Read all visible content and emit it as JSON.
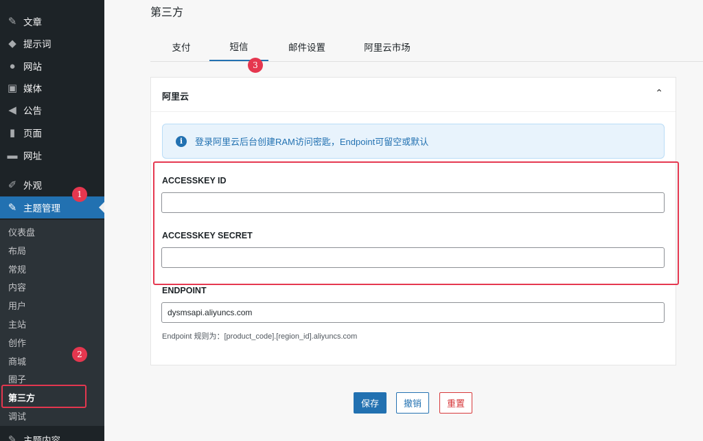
{
  "sidebar": {
    "top_items": [
      {
        "label": "文章",
        "icon": "pushpin-icon"
      },
      {
        "label": "提示词",
        "icon": "tag-icon"
      },
      {
        "label": "网站",
        "icon": "globe-icon"
      },
      {
        "label": "媒体",
        "icon": "media-icon"
      },
      {
        "label": "公告",
        "icon": "megaphone-icon"
      },
      {
        "label": "页面",
        "icon": "page-icon"
      },
      {
        "label": "网址",
        "icon": "folder-icon"
      },
      {
        "label": "外观",
        "icon": "brush-icon"
      },
      {
        "label": "主题管理",
        "icon": "paintbrush-icon"
      }
    ],
    "submenu": [
      "仪表盘",
      "布局",
      "常规",
      "内容",
      "用户",
      "主站",
      "创作",
      "商城",
      "圈子",
      "第三方",
      "调试"
    ],
    "bottom_item": "主题内容"
  },
  "badges": [
    "1",
    "2",
    "3"
  ],
  "page_title": "第三方",
  "tabs": [
    "支付",
    "短信",
    "邮件设置",
    "阿里云市场"
  ],
  "panel": {
    "title": "阿里云",
    "notice": "登录阿里云后台创建RAM访问密匙，Endpoint可留空或默认",
    "fields": {
      "accesskey_id": {
        "label": "ACCESSKEY ID",
        "value": ""
      },
      "accesskey_secret": {
        "label": "ACCESSKEY SECRET",
        "value": ""
      },
      "endpoint": {
        "label": "ENDPOINT",
        "value": "dysmsapi.aliyuncs.com",
        "help": "Endpoint 规则为：[product_code].[region_id].aliyuncs.com"
      }
    }
  },
  "buttons": {
    "save": "保存",
    "cancel": "撤销",
    "reset": "重置"
  },
  "colors": {
    "accent": "#2271b1",
    "highlight": "#e5374f",
    "sidebar_bg": "#1d2327"
  }
}
